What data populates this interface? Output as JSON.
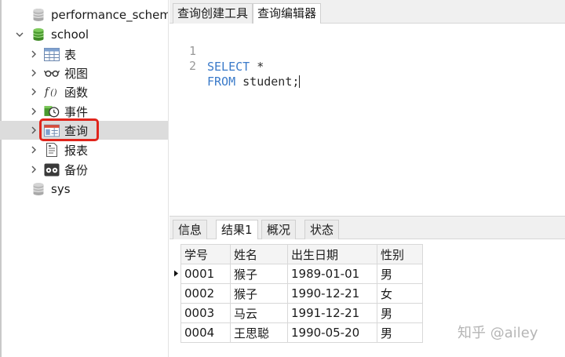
{
  "tree": {
    "items": [
      {
        "label": "performance_schema",
        "icon": "database-icon"
      },
      {
        "label": "school",
        "icon": "database-icon"
      },
      {
        "label": "表",
        "icon": "table-icon"
      },
      {
        "label": "视图",
        "icon": "view-glasses-icon"
      },
      {
        "label": "函数",
        "icon": "function-icon"
      },
      {
        "label": "事件",
        "icon": "event-clock-icon"
      },
      {
        "label": "查询",
        "icon": "query-icon"
      },
      {
        "label": "报表",
        "icon": "report-icon"
      },
      {
        "label": "备份",
        "icon": "backup-icon"
      },
      {
        "label": "sys",
        "icon": "database-icon"
      }
    ],
    "selected": "查询",
    "highlight_color": "#e0251c"
  },
  "editor": {
    "tabs": [
      "查询创建工具",
      "查询编辑器"
    ],
    "active_tab": "查询编辑器",
    "lines": [
      {
        "num": "1",
        "keyword": "SELECT",
        "rest": " *"
      },
      {
        "num": "2",
        "keyword": "FROM",
        "rest": " student;"
      }
    ],
    "keyword_color": "#3a7ac9"
  },
  "result": {
    "tabs": [
      "信息",
      "结果1",
      "概况",
      "状态"
    ],
    "active_tab": "结果1",
    "columns": [
      "学号",
      "姓名",
      "出生日期",
      "性别"
    ],
    "rows": [
      [
        "0001",
        "猴子",
        "1989-01-01",
        "男"
      ],
      [
        "0002",
        "猴子",
        "1990-12-21",
        "女"
      ],
      [
        "0003",
        "马云",
        "1991-12-21",
        "男"
      ],
      [
        "0004",
        "王思聪",
        "1990-05-20",
        "男"
      ]
    ]
  },
  "watermark": "知乎 @ailey"
}
